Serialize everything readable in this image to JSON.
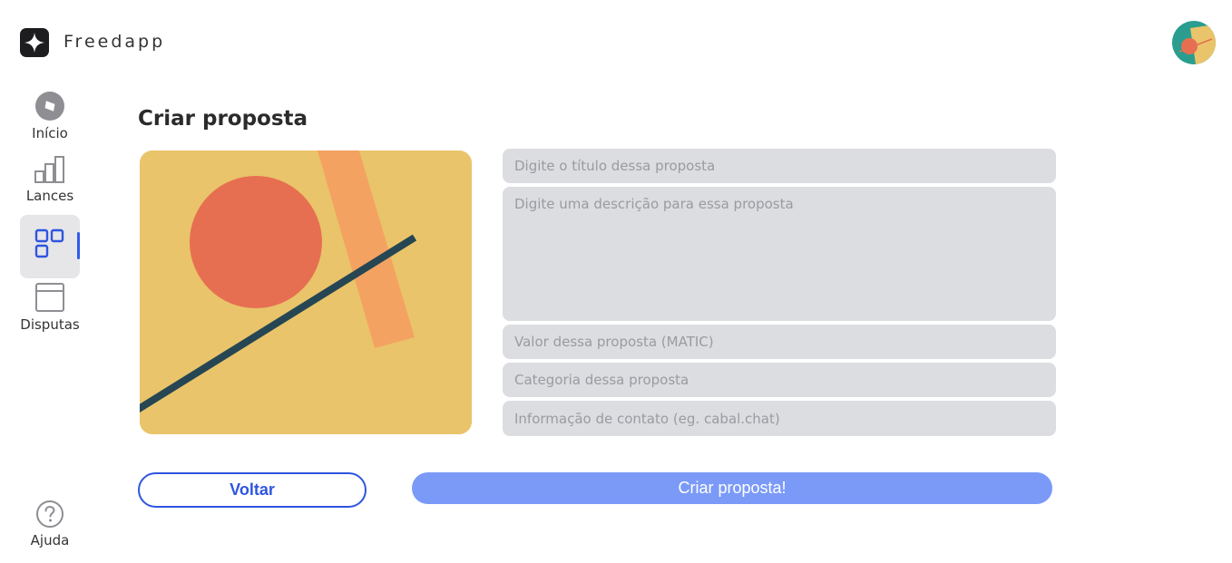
{
  "header": {
    "brand": "Freedapp"
  },
  "sidebar": {
    "items": [
      {
        "label": "Início",
        "icon": "compass-icon"
      },
      {
        "label": "Lances",
        "icon": "bar-chart-icon"
      },
      {
        "label": "",
        "icon": "grid-icon",
        "active": true
      },
      {
        "label": "Disputas",
        "icon": "browser-window-icon"
      }
    ],
    "help": {
      "label": "Ajuda",
      "icon": "help-icon"
    }
  },
  "main": {
    "title": "Criar proposta",
    "form": {
      "title_placeholder": "Digite o título dessa proposta",
      "description_placeholder": "Digite uma descrição para essa proposta",
      "value_placeholder": "Valor dessa proposta (MATIC)",
      "category_placeholder": "Categoria dessa proposta",
      "contact_placeholder": "Informação de contato (eg. cabal.chat)"
    },
    "buttons": {
      "back_label": "Voltar",
      "create_label": "Criar proposta!"
    }
  },
  "colors": {
    "accent": "#2f55e0",
    "create_button": "#7b9af8",
    "field_bg": "#dcdde0",
    "art_bg": "#e9c46a",
    "art_circle": "#e76f51",
    "art_stripe": "#f4a261",
    "art_line": "#264653"
  }
}
